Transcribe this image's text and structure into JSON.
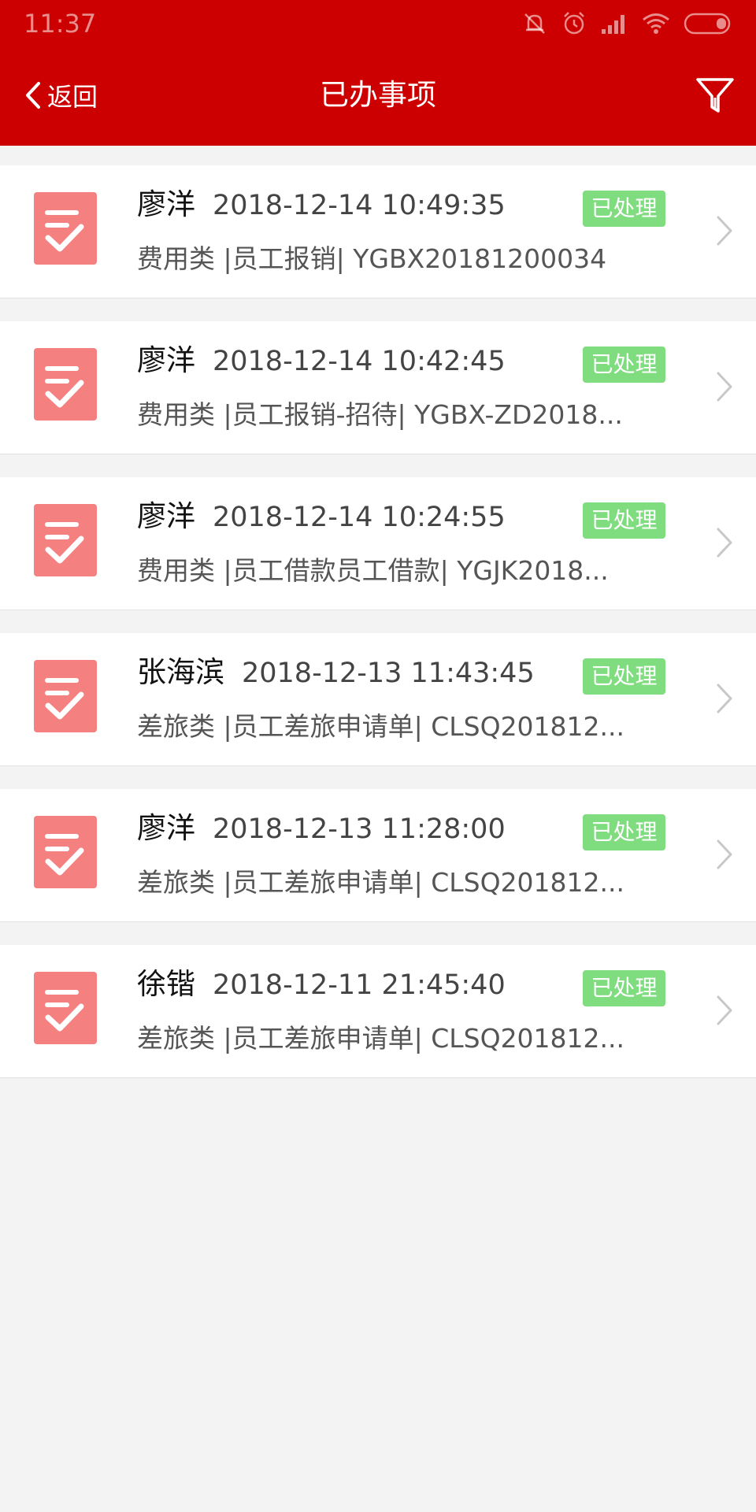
{
  "status_bar": {
    "time": "11:37",
    "icons": [
      "mute-icon",
      "alarm-icon",
      "signal-icon",
      "wifi-icon",
      "battery-icon"
    ]
  },
  "nav": {
    "back_label": "返回",
    "title": "已办事项",
    "filter_icon": "filter-icon"
  },
  "colors": {
    "brand": "#cc0000",
    "badge": "#7fdc7f",
    "item_icon": "#f58080",
    "background": "#f3f3f3"
  },
  "items": [
    {
      "name": "廖洋",
      "time": "2018-12-14 10:49:35",
      "status": "已处理",
      "desc": "费用类 |员工报销| YGBX20181200034",
      "icon": "task-check-icon"
    },
    {
      "name": "廖洋",
      "time": "2018-12-14 10:42:45",
      "status": "已处理",
      "desc": "费用类 |员工报销-招待| YGBX-ZD2018...",
      "icon": "task-check-icon"
    },
    {
      "name": "廖洋",
      "time": "2018-12-14 10:24:55",
      "status": "已处理",
      "desc": "费用类 |员工借款员工借款| YGJK2018...",
      "icon": "task-check-icon"
    },
    {
      "name": "张海滨",
      "time": "2018-12-13 11:43:45",
      "status": "已处理",
      "desc": "差旅类 |员工差旅申请单| CLSQ201812...",
      "icon": "task-check-icon"
    },
    {
      "name": "廖洋",
      "time": "2018-12-13 11:28:00",
      "status": "已处理",
      "desc": "差旅类 |员工差旅申请单| CLSQ201812...",
      "icon": "task-check-icon"
    },
    {
      "name": "徐锴",
      "time": "2018-12-11 21:45:40",
      "status": "已处理",
      "desc": "差旅类 |员工差旅申请单| CLSQ201812...",
      "icon": "task-check-icon"
    }
  ]
}
